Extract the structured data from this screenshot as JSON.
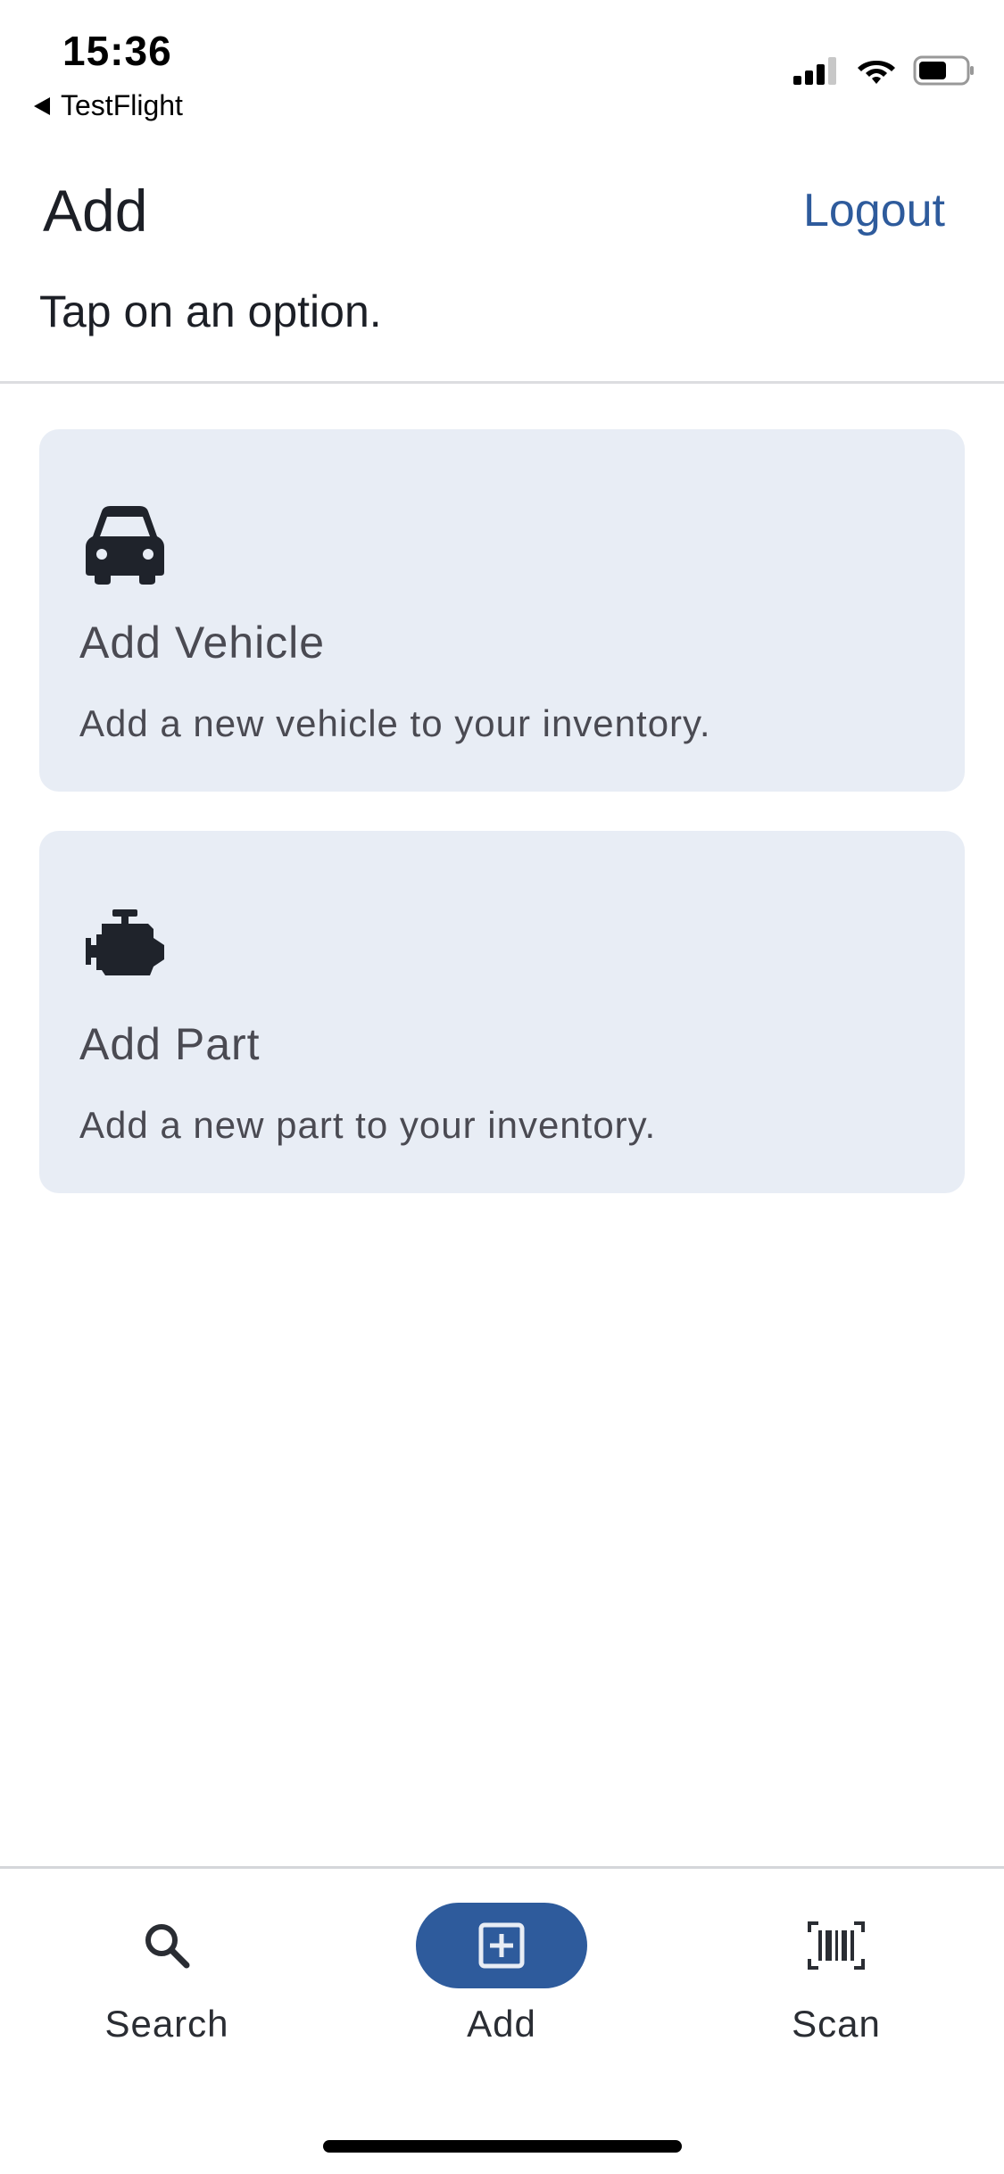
{
  "status_bar": {
    "time": "15:36",
    "back_label": "TestFlight"
  },
  "header": {
    "title": "Add",
    "logout_label": "Logout",
    "subtitle": "Tap on an option."
  },
  "options": [
    {
      "icon": "car-icon",
      "title": "Add Vehicle",
      "description": "Add a new vehicle to your inventory."
    },
    {
      "icon": "engine-icon",
      "title": "Add Part",
      "description": "Add a new part to your inventory."
    }
  ],
  "bottom_nav": {
    "items": [
      {
        "icon": "search-icon",
        "label": "Search",
        "active": false
      },
      {
        "icon": "add-box-icon",
        "label": "Add",
        "active": true
      },
      {
        "icon": "barcode-icon",
        "label": "Scan",
        "active": false
      }
    ]
  },
  "colors": {
    "accent": "#2e5b9c",
    "card_background": "#e8edf5",
    "text": "#1c1f26",
    "secondary_text": "#4a4a52"
  }
}
